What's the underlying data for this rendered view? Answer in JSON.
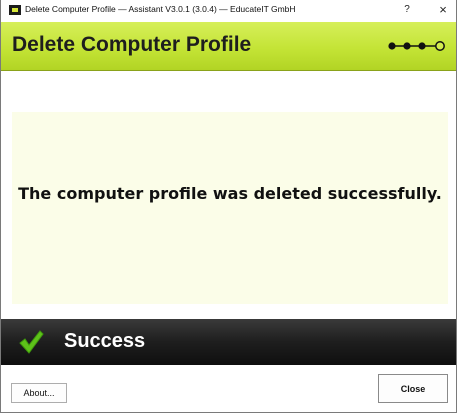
{
  "window": {
    "title": "Delete Computer Profile — Assistant V3.0.1 (3.0.4) — EducateIT GmbH",
    "help_label": "?",
    "close_glyph": "×"
  },
  "header": {
    "title": "Delete Computer Profile",
    "steps": {
      "total": 4,
      "completed": 3
    },
    "accent_color": "#c4e436"
  },
  "content": {
    "message": "The computer profile was deleted successfully."
  },
  "status": {
    "icon": "checkmark-icon",
    "text": "Success",
    "icon_color": "#5ec21a"
  },
  "buttons": {
    "about_label": "About...",
    "close_label": "Close"
  }
}
